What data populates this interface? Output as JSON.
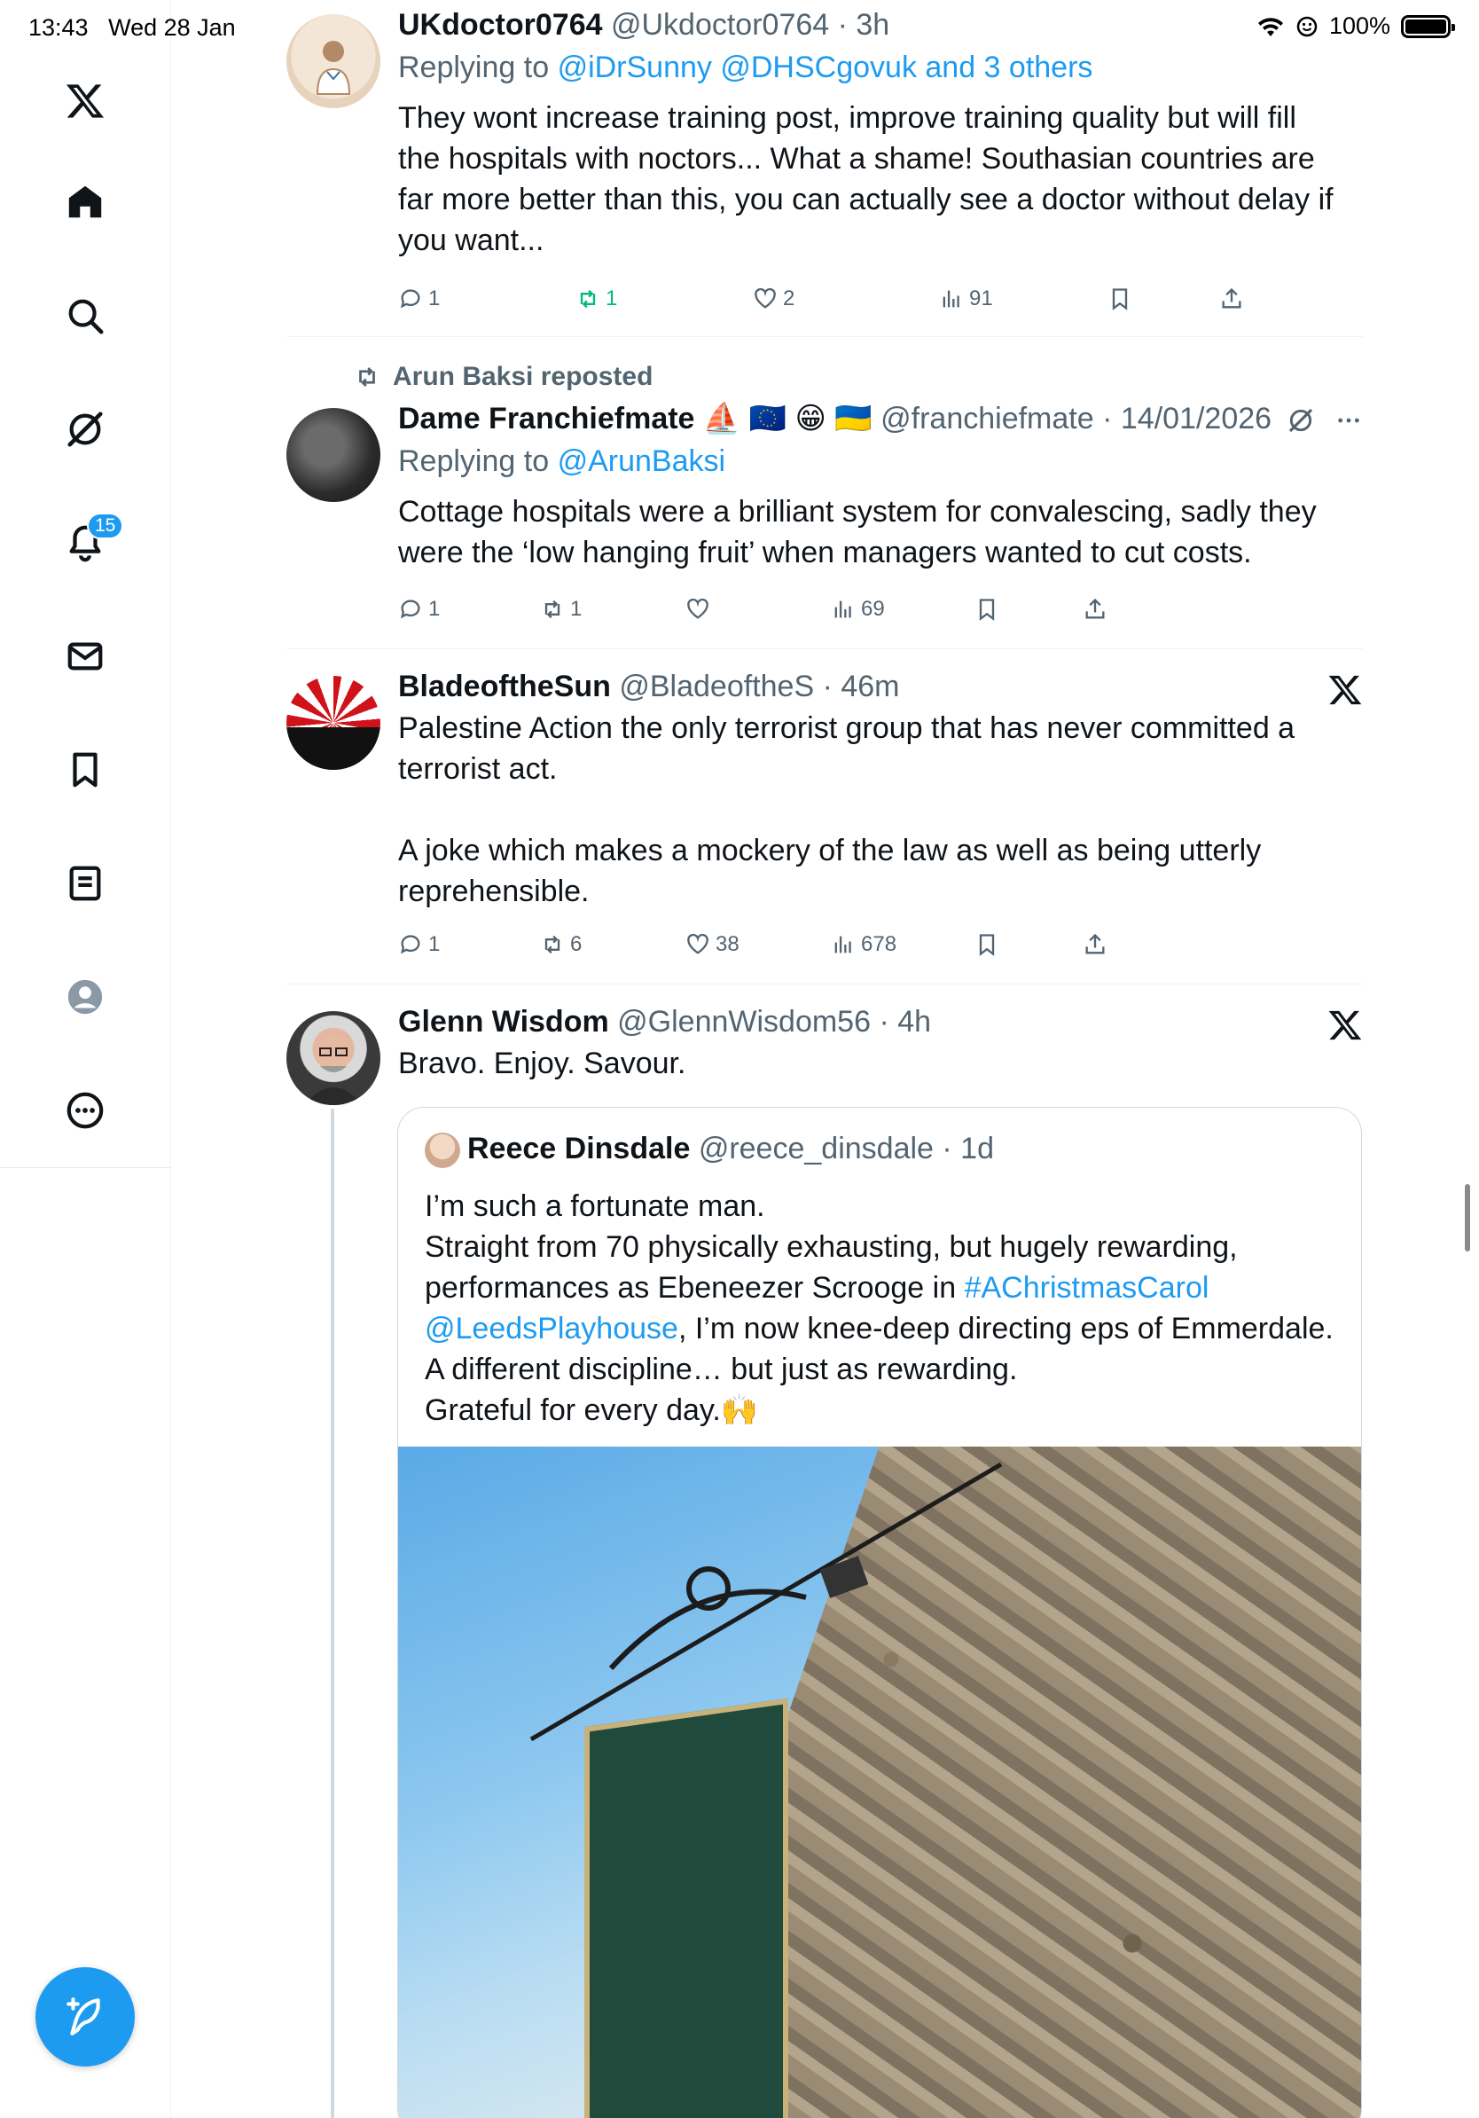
{
  "status_bar": {
    "time": "13:43",
    "date": "Wed 28 Jan",
    "battery": "100%"
  },
  "sidebar": {
    "notifications_badge": "15"
  },
  "posts": [
    {
      "name": "UKdoctor0764",
      "handle": "@Ukdoctor0764",
      "time": "3h",
      "replying_prefix": "Replying to",
      "replying_to": "@iDrSunny @DHSCgovuk and 3 others",
      "text": "They wont increase training post,  improve training quality but will fill\nthe hospitals with noctors... What a shame! Southasian countries are\nfar more better than this,  you can actually see a doctor without delay if\nyou want...",
      "replies": "1",
      "reposts": "1",
      "likes": "2",
      "views": "91"
    },
    {
      "repost_label": "Arun Baksi reposted",
      "name": "Dame Franchiefmate ⛵ 🇪🇺 😁 🇺🇦",
      "handle": "@franchiefmate",
      "time": "14/01/2026",
      "replying_prefix": "Replying to",
      "replying_to": "@ArunBaksi",
      "text": "Cottage hospitals were a brilliant system for convalescing, sadly they\nwere the ‘low hanging fruit’ when managers wanted to cut costs.",
      "replies": "1",
      "reposts": "1",
      "likes": "",
      "views": "69"
    },
    {
      "name": "BladeoftheSun",
      "handle": "@BladeoftheS",
      "time": "46m",
      "text": "Palestine Action the only terrorist group that has never committed a\nterrorist act.\n\nA joke which makes a mockery of the law as well as being utterly\nreprehensible.",
      "replies": "1",
      "reposts": "6",
      "likes": "38",
      "views": "678"
    },
    {
      "name": "Glenn Wisdom",
      "handle": "@GlennWisdom56",
      "time": "4h",
      "text": "Bravo. Enjoy. Savour."
    }
  ],
  "quote": {
    "name": "Reece Dinsdale",
    "handle": "@reece_dinsdale",
    "time": "1d",
    "line1": "I’m such a fortunate man.",
    "line2": "Straight from 70 physically exhausting, but hugely rewarding,",
    "line3_a": "performances as Ebeneezer Scrooge in ",
    "hashtag": "#AChristmasCarol",
    "mention": "@LeedsPlayhouse",
    "line4_b": ", I’m now knee-deep directing eps of Emmerdale.",
    "line5": "A different discipline… but just as rewarding.",
    "line6": "Grateful for every day.🙌"
  },
  "icons": {
    "logo": "x-logo-icon",
    "home": "home-icon",
    "search": "search-icon",
    "grok": "grok-icon",
    "notifications": "bell-icon",
    "messages": "mail-icon",
    "bookmarks": "bookmark-icon",
    "lists": "lists-icon",
    "profile": "profile-icon",
    "more": "more-icon",
    "compose": "compose-icon"
  },
  "colors": {
    "accent": "#1d9bf0",
    "repost_active": "#00ba7c",
    "muted": "#536471"
  }
}
